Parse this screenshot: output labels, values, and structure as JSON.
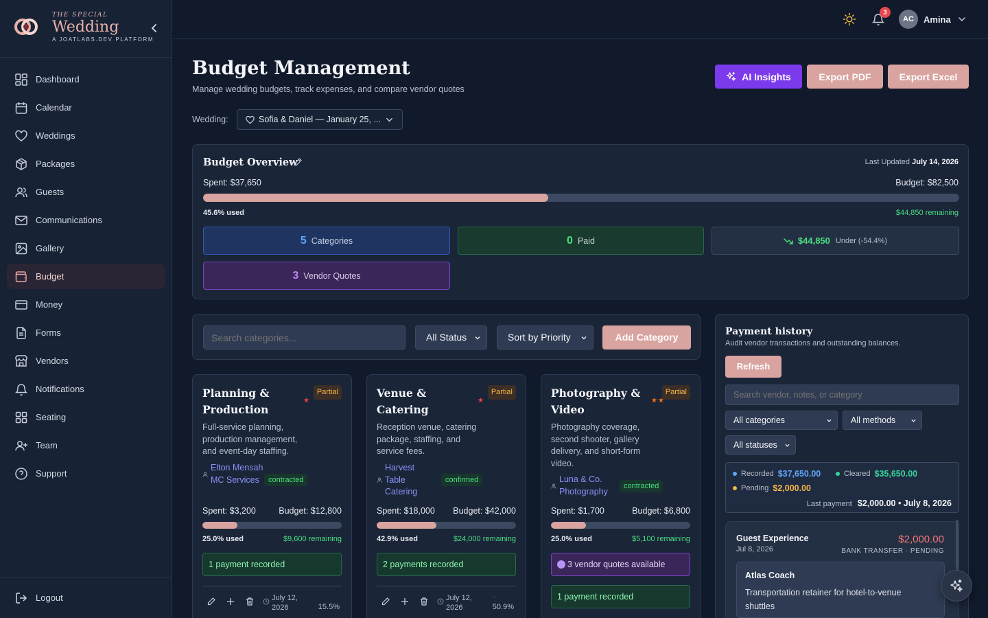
{
  "brand": {
    "kicker": "THE SPECIAL",
    "title": "Wedding",
    "sub": "A JOATLABS.DEV PLATFORM"
  },
  "sidebar": {
    "items": [
      {
        "label": "Dashboard",
        "icon": "dashboard-icon"
      },
      {
        "label": "Calendar",
        "icon": "calendar-icon"
      },
      {
        "label": "Weddings",
        "icon": "heart-icon"
      },
      {
        "label": "Packages",
        "icon": "package-icon"
      },
      {
        "label": "Guests",
        "icon": "users-icon"
      },
      {
        "label": "Communications",
        "icon": "mail-icon"
      },
      {
        "label": "Gallery",
        "icon": "image-icon"
      },
      {
        "label": "Budget",
        "icon": "wallet-icon",
        "active": true
      },
      {
        "label": "Money",
        "icon": "credit-card-icon"
      },
      {
        "label": "Forms",
        "icon": "file-text-icon"
      },
      {
        "label": "Vendors",
        "icon": "store-icon"
      },
      {
        "label": "Notifications",
        "icon": "bell-icon"
      },
      {
        "label": "Seating",
        "icon": "grid-icon"
      },
      {
        "label": "Team",
        "icon": "user-plus-icon"
      },
      {
        "label": "Support",
        "icon": "help-circle-icon"
      }
    ],
    "logout": "Logout"
  },
  "topbar": {
    "notification_count": "3",
    "avatar_initials": "AC",
    "user_name": "Amina"
  },
  "header": {
    "title": "Budget Management",
    "subtitle": "Manage wedding budgets, track expenses, and compare vendor quotes",
    "ai_label": "AI Insights",
    "export_pdf": "Export PDF",
    "export_excel": "Export Excel",
    "wedding_label": "Wedding:",
    "wedding_value": "Sofia & Daniel — January 25, ..."
  },
  "overview": {
    "title": "Budget Overview",
    "updated_label": "Last Updated",
    "updated_date": "July 14, 2026",
    "spent": "Spent: $37,650",
    "budget": "Budget: $82,500",
    "used_fraction": 0.456,
    "used": "45.6% used",
    "remaining": "$44,850 remaining",
    "categories_count": "5",
    "categories_label": "Categories",
    "paid_count": "0",
    "paid_label": "Paid",
    "under_amount": "$44,850",
    "under_label": "Under (-54.4%)",
    "quotes_count": "3",
    "quotes_label": "Vendor Quotes"
  },
  "filters": {
    "search_placeholder": "Search categories...",
    "status": "All Status",
    "sort": "Sort by Priority",
    "add": "Add Category"
  },
  "categories": [
    {
      "title": "Planning & Production",
      "badge": "Partial",
      "stars": "★",
      "desc": "Full-service planning, production management, and event-day staffing.",
      "vendor": "Elton Mensah MC Services",
      "vendor_status": "contracted",
      "spent": "Spent: $3,200",
      "budget": "Budget: $12,800",
      "used_fraction": 0.25,
      "used": "25.0% used",
      "remaining": "$9,600 remaining",
      "payment": "1 payment recorded",
      "date": "July 12, 2026",
      "pct": "15.5%"
    },
    {
      "title": "Venue & Catering",
      "badge": "Partial",
      "stars": "★",
      "desc": "Reception venue, catering package, staffing, and service fees.",
      "vendor": "Harvest Table Catering",
      "vendor_status": "confirmed",
      "spent": "Spent: $18,000",
      "budget": "Budget: $42,000",
      "used_fraction": 0.429,
      "used": "42.9% used",
      "remaining": "$24,000 remaining",
      "payment": "2 payments recorded",
      "date": "July 12, 2026",
      "pct": "50.9%"
    },
    {
      "title": "Photography & Video",
      "badge": "Partial",
      "stars": "★★",
      "desc": "Photography coverage, second shooter, gallery delivery, and short-form video.",
      "vendor": "Luna & Co. Photography",
      "vendor_status": "contracted",
      "spent": "Spent: $1,700",
      "budget": "Budget: $6,800",
      "used_fraction": 0.25,
      "used": "25.0% used",
      "remaining": "$5,100 remaining",
      "quotes": "3 vendor quotes available",
      "payment": "1 payment recorded"
    }
  ],
  "payments": {
    "title": "Payment history",
    "subtitle": "Audit vendor transactions and outstanding balances.",
    "refresh": "Refresh",
    "search_placeholder": "Search vendor, notes, or category",
    "category_filter": "All categories",
    "method_filter": "All methods",
    "status_filter": "All statuses",
    "recorded_label": "Recorded",
    "recorded_value": "$37,650.00",
    "cleared_label": "Cleared",
    "cleared_value": "$35,650.00",
    "pending_label": "Pending",
    "pending_value": "$2,000.00",
    "last_label": "Last payment",
    "last_value": "$2,000.00 • July 8, 2026",
    "item": {
      "category": "Guest Experience",
      "date": "Jul 8, 2026",
      "amount": "$2,000.00",
      "meta": "BANK TRANSFER · PENDING",
      "vendor": "Atlas Coach",
      "note": "Transportation retainer for hotel-to-venue shuttles"
    }
  },
  "colors": {
    "accent": "#d9a3a0",
    "ai_purple": "#7c3aed",
    "success": "#4ade80",
    "warning": "#f6b54a",
    "danger": "#f47476"
  }
}
